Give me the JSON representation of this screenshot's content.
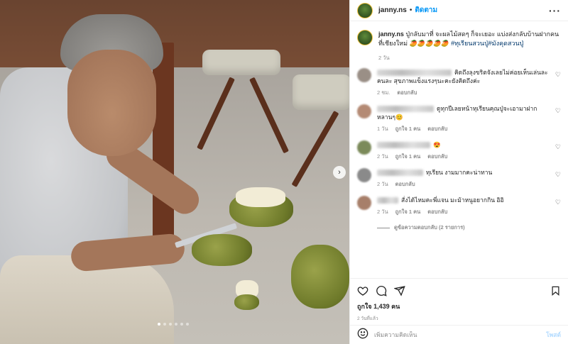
{
  "header": {
    "username": "janny.ns",
    "separator": "•",
    "follow_label": "ติดตาม",
    "more_label": "···"
  },
  "caption": {
    "username": "janny.ns",
    "text": "ปู่กลับมาที่ จะผลไม้สดๆ ก็จะเยอะ แบ่งส่งกลับบ้านฝากคนที่เชียงใหม่ 🥭🥭🥭🥭🥭",
    "tags": "#ทุเรียนสวนปู่#มังคุดสวนปู่",
    "time": "2 วัน"
  },
  "comments": [
    {
      "text": "คิดถึงลุงขริตจังเลยไม่ค่อยเห็นเล่นละคนละ สุขภาพแข็งแรงๆนะคะยังคิดถึงค่ะ",
      "time": "2 ชม.",
      "likes": "",
      "reply": "ตอบกลับ",
      "avatar_color": "#9a8f86"
    },
    {
      "text": "ดูทุกปีเลยหน้าทุเรียนคุณปู่จะเอามาฝากหลานๆ😊",
      "time": "1 วัน",
      "likes": "ถูกใจ 1 คน",
      "reply": "ตอบกลับ",
      "avatar_color": "#b48a74"
    },
    {
      "text": "😍",
      "time": "2 วัน",
      "likes": "ถูกใจ 1 คน",
      "reply": "ตอบกลับ",
      "avatar_color": "#7b8a5a"
    },
    {
      "text": "ทุเรียน งามมากคะน่าทาน",
      "time": "2 วัน",
      "likes": "",
      "reply": "ตอบกลับ",
      "avatar_color": "#8a8a8a"
    },
    {
      "text": "สั่งได้ไหมคะพี่แจน มะม้าหนูอยากกิน อิอิ",
      "time": "2 วัน",
      "likes": "ถูกใจ 1 คน",
      "reply": "ตอบกลับ",
      "avatar_color": "#a77f6a"
    }
  ],
  "view_replies": "ดูข้อความตอบกลับ (2 รายการ)",
  "likes_text": "ถูกใจ 1,439 คน",
  "posted_time": "2 วันที่แล้ว",
  "add_comment": {
    "placeholder": "เพิ่มความคิดเห็น",
    "post_label": "โพสต์"
  },
  "carousel": {
    "slide_count": 6,
    "active_index": 0,
    "next_label": "›"
  },
  "colors": {
    "accent": "#0095f6",
    "post_disabled": "#b3dbff"
  }
}
